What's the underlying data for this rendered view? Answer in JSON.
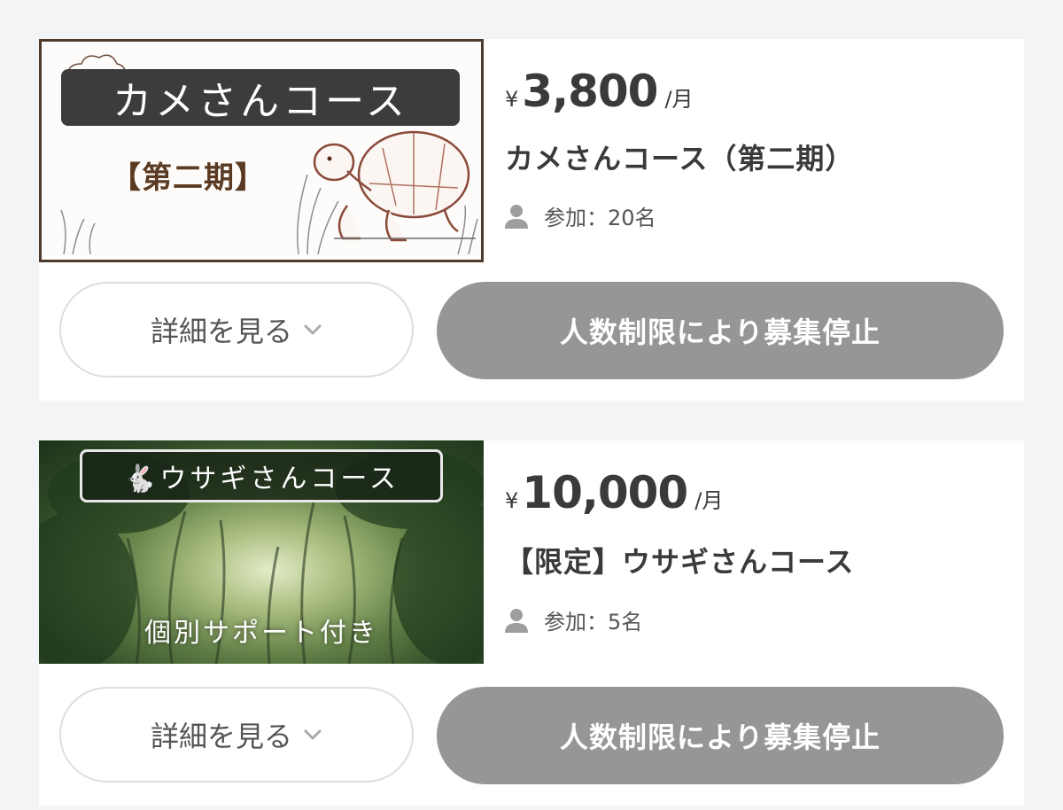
{
  "courses": [
    {
      "thumbnail": {
        "title": "カメさんコース",
        "subtitle": "【第二期】"
      },
      "price": {
        "currency": "¥",
        "amount": "3,800",
        "period": "/月"
      },
      "title": "カメさんコース（第二期）",
      "members": "参加：20名",
      "detail_button": "詳細を見る",
      "status_button": "人数制限により募集停止"
    },
    {
      "thumbnail": {
        "title": "🐇ウサギさんコース",
        "subtitle": "個別サポート付き"
      },
      "price": {
        "currency": "¥",
        "amount": "10,000",
        "period": "/月"
      },
      "title": "【限定】ウサギさんコース",
      "members": "参加：5名",
      "detail_button": "詳細を見る",
      "status_button": "人数制限により募集停止"
    }
  ],
  "colors": {
    "page_background": "#f3f4f6",
    "card_background": "#ffffff",
    "disabled_button": "#969696",
    "text": "#3a3a3a"
  },
  "icons": [
    "person-icon",
    "chevron-down-icon",
    "turtle-illustration",
    "forest-image"
  ]
}
